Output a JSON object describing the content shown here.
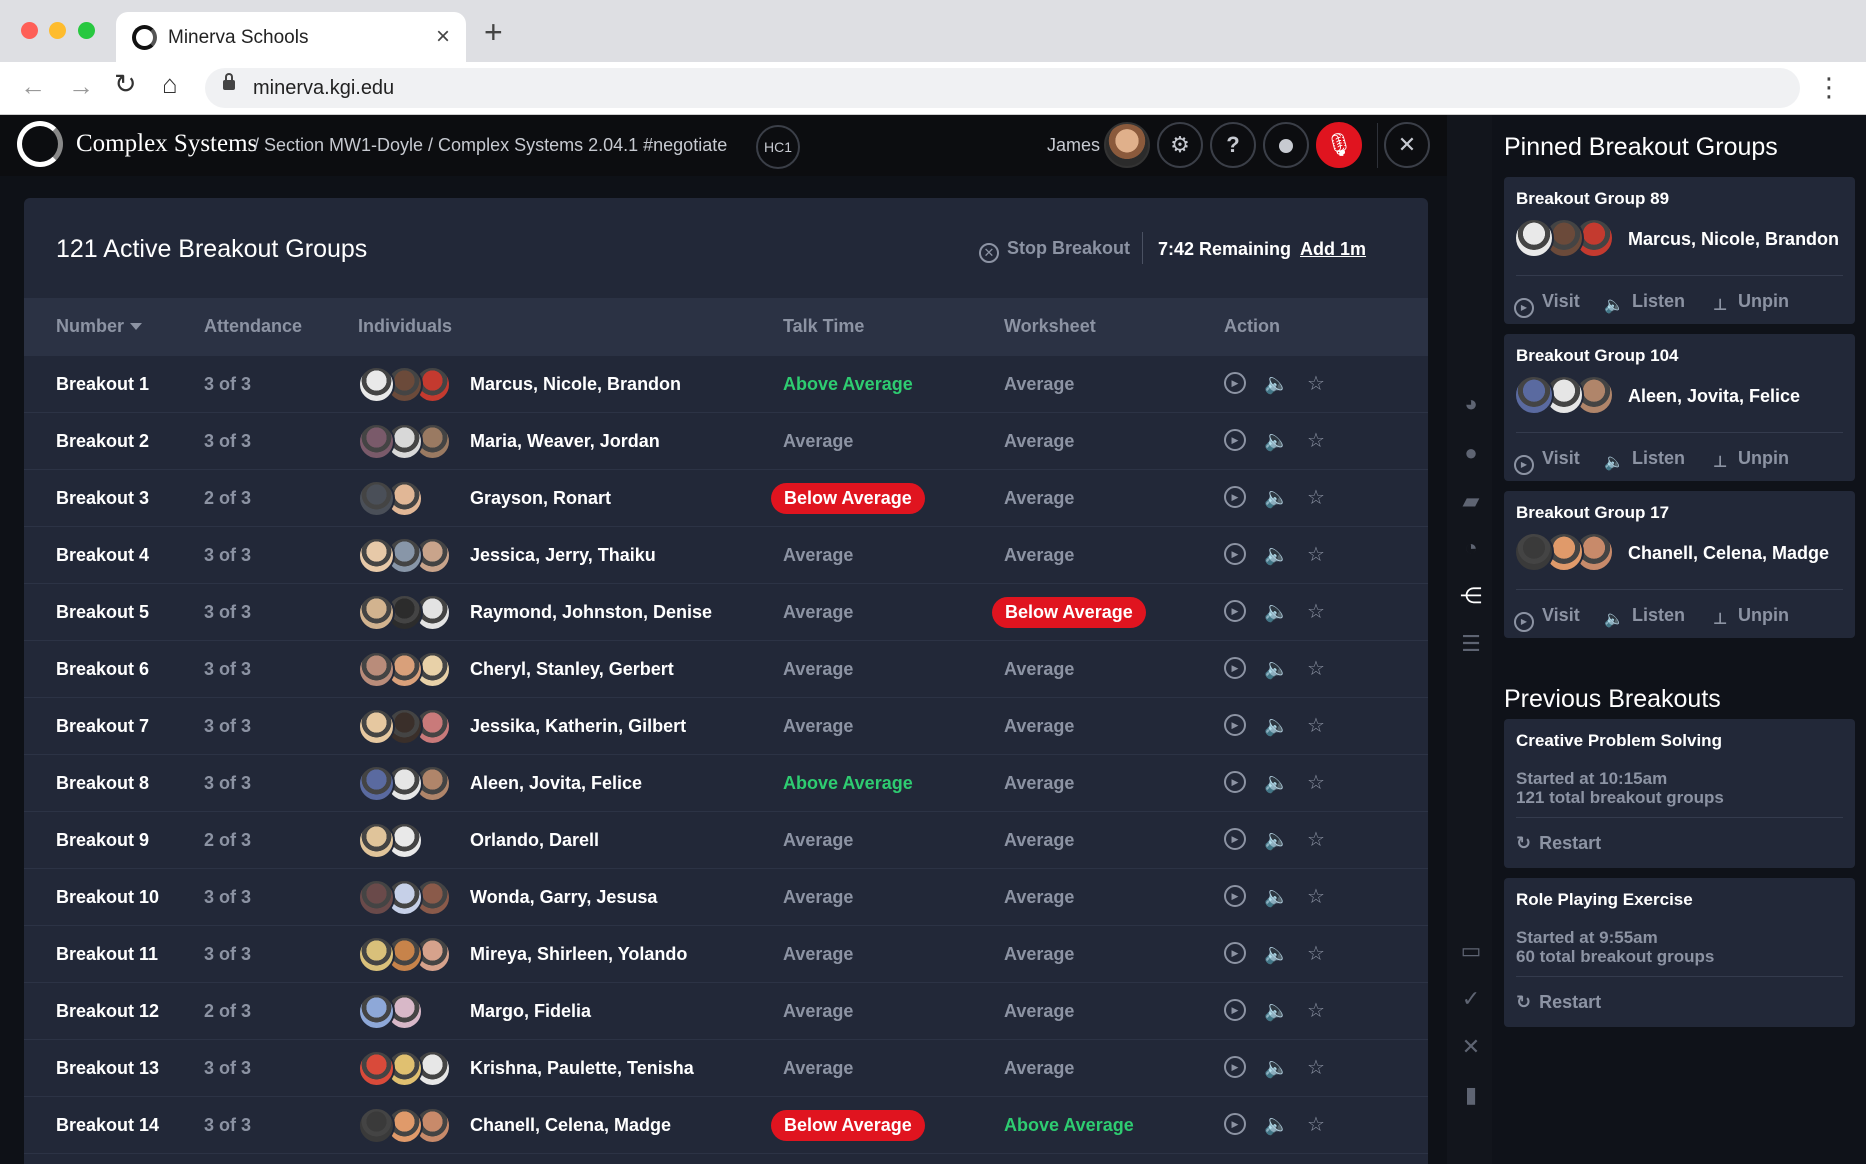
{
  "browser": {
    "tab_title": "Minerva Schools",
    "tab_close": "×",
    "new_tab": "+",
    "url": "minerva.kgi.edu",
    "back": "←",
    "forward": "→",
    "reload": "↻",
    "home": "⌂",
    "menu": "⋮"
  },
  "header": {
    "course": "Complex Systems",
    "breadcrumb": "/ Section MW1-Doyle / Complex Systems 2.04.1 #negotiate",
    "badge": "HC1",
    "user_name": "James",
    "settings_glyph": "⚙",
    "help_glyph": "?",
    "close_glyph": "✕",
    "mic_glyph": "🎙"
  },
  "main": {
    "title": "121 Active Breakout Groups",
    "stop_label": "Stop Breakout",
    "remaining": "7:42 Remaining",
    "add_time": "Add 1m",
    "columns": {
      "number": "Number",
      "attendance": "Attendance",
      "individuals": "Individuals",
      "talk_time": "Talk Time",
      "worksheet": "Worksheet",
      "action": "Action"
    },
    "rows": [
      {
        "name": "Breakout 1",
        "attendance": "3 of 3",
        "people": "Marcus, Nicole, Brandon",
        "talk": "Above Average",
        "talk_status": "above",
        "work": "Average",
        "work_status": "avg",
        "avatars": [
          "#e9e9e9",
          "#6b4a3a",
          "#c43a2f"
        ]
      },
      {
        "name": "Breakout 2",
        "attendance": "3 of 3",
        "people": "Maria, Weaver, Jordan",
        "talk": "Average",
        "talk_status": "avg",
        "work": "Average",
        "work_status": "avg",
        "avatars": [
          "#7a5a6a",
          "#d8d8d8",
          "#9a7a62"
        ]
      },
      {
        "name": "Breakout 3",
        "attendance": "2 of 3",
        "people": "Grayson, Ronart",
        "talk": "Below Average",
        "talk_status": "below",
        "work": "Average",
        "work_status": "avg",
        "avatars": [
          "#4a4f58",
          "#e1b796"
        ]
      },
      {
        "name": "Breakout 4",
        "attendance": "3 of 3",
        "people": "Jessica, Jerry, Thaiku",
        "talk": "Average",
        "talk_status": "avg",
        "work": "Average",
        "work_status": "avg",
        "avatars": [
          "#e7c9a8",
          "#8896a8",
          "#c9a48b"
        ]
      },
      {
        "name": "Breakout 5",
        "attendance": "3 of 3",
        "people": "Raymond, Johnston, Denise",
        "talk": "Average",
        "talk_status": "avg",
        "work": "Below Average",
        "work_status": "below",
        "avatars": [
          "#d2b38f",
          "#2c2c2c",
          "#e3e3e3"
        ]
      },
      {
        "name": "Breakout 6",
        "attendance": "3 of 3",
        "people": "Cheryl, Stanley, Gerbert",
        "talk": "Average",
        "talk_status": "avg",
        "work": "Average",
        "work_status": "avg",
        "avatars": [
          "#b98c7a",
          "#d9a07a",
          "#e8d1a8"
        ]
      },
      {
        "name": "Breakout 7",
        "attendance": "3 of 3",
        "people": "Jessika, Katherin, Gilbert",
        "talk": "Average",
        "talk_status": "avg",
        "work": "Average",
        "work_status": "avg",
        "avatars": [
          "#e6c8a0",
          "#3a2f2a",
          "#c97a7a"
        ]
      },
      {
        "name": "Breakout 8",
        "attendance": "3 of 3",
        "people": "Aleen, Jovita, Felice",
        "talk": "Above Average",
        "talk_status": "above",
        "work": "Average",
        "work_status": "avg",
        "avatars": [
          "#5a6aa0",
          "#e6e6e6",
          "#b0856a"
        ]
      },
      {
        "name": "Breakout 9",
        "attendance": "2 of 3",
        "people": "Orlando, Darell",
        "talk": "Average",
        "talk_status": "avg",
        "work": "Average",
        "work_status": "avg",
        "avatars": [
          "#e0c49a",
          "#e9e9e9"
        ]
      },
      {
        "name": "Breakout 10",
        "attendance": "3 of 3",
        "people": "Wonda, Garry, Jesusa",
        "talk": "Average",
        "talk_status": "avg",
        "work": "Average",
        "work_status": "avg",
        "avatars": [
          "#6a4a4a",
          "#c6d0e8",
          "#8a5a4a"
        ]
      },
      {
        "name": "Breakout 11",
        "attendance": "3 of 3",
        "people": "Mireya, Shirleen, Yolando",
        "talk": "Average",
        "talk_status": "avg",
        "work": "Average",
        "work_status": "avg",
        "avatars": [
          "#d9c07a",
          "#c7834a",
          "#d6a28c"
        ]
      },
      {
        "name": "Breakout 12",
        "attendance": "2 of 3",
        "people": "Margo, Fidelia",
        "talk": "Average",
        "talk_status": "avg",
        "work": "Average",
        "work_status": "avg",
        "avatars": [
          "#8ea8d8",
          "#d8b8c8"
        ]
      },
      {
        "name": "Breakout 13",
        "attendance": "3 of 3",
        "people": "Krishna, Paulette, Tenisha",
        "talk": "Average",
        "talk_status": "avg",
        "work": "Average",
        "work_status": "avg",
        "avatars": [
          "#d94a3a",
          "#e0c070",
          "#e7e7e7"
        ]
      },
      {
        "name": "Breakout 14",
        "attendance": "3 of 3",
        "people": "Chanell, Celena, Madge",
        "talk": "Below Average",
        "talk_status": "below",
        "work": "Above Average",
        "work_status": "above",
        "avatars": [
          "#3a3a3a",
          "#e09a6a",
          "#c88a6a"
        ]
      }
    ]
  },
  "pinned": {
    "heading": "Pinned Breakout Groups",
    "visit": "Visit",
    "listen": "Listen",
    "unpin": "Unpin",
    "groups": [
      {
        "title": "Breakout Group 89",
        "people": "Marcus, Nicole, Brandon",
        "avatars": [
          "#e9e9e9",
          "#6b4a3a",
          "#c43a2f"
        ]
      },
      {
        "title": "Breakout Group 104",
        "people": "Aleen, Jovita, Felice",
        "avatars": [
          "#5a6aa0",
          "#e6e6e6",
          "#b0856a"
        ]
      },
      {
        "title": "Breakout Group 17",
        "people": "Chanell, Celena, Madge",
        "avatars": [
          "#3a3a3a",
          "#e09a6a",
          "#c88a6a"
        ]
      }
    ]
  },
  "previous": {
    "heading": "Previous Breakouts",
    "restart": "Restart",
    "items": [
      {
        "title": "Creative Problem Solving",
        "started": "Started at 10:15am",
        "total": "121 total breakout groups"
      },
      {
        "title": "Role Playing Exercise",
        "started": "Started at 9:55am",
        "total": "60 total breakout groups"
      }
    ]
  },
  "colors": {
    "accent_red": "#e0141f",
    "above_green": "#2ecc71",
    "panel": "#222838",
    "muted": "#8c93a3"
  },
  "rail_icons": [
    "palette-icon",
    "chat-icon",
    "folder-icon",
    "pie-chart-icon",
    "share-icon",
    "list-icon",
    "monitor-icon",
    "check-icon",
    "close-icon",
    "bookmark-icon"
  ]
}
